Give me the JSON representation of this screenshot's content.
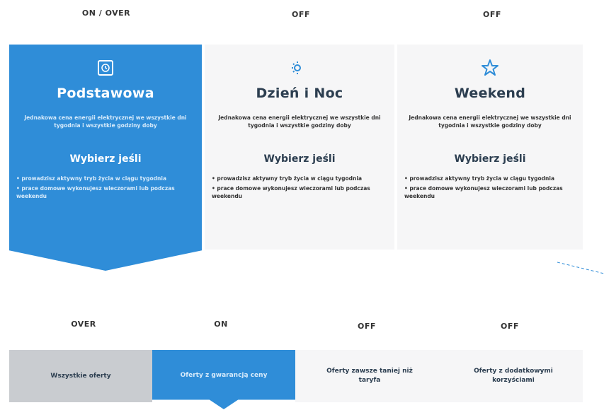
{
  "labels": {
    "top": [
      "ON / OVER",
      "OFF",
      "OFF"
    ],
    "bottom": [
      "OVER",
      "ON",
      "OFF",
      "OFF"
    ]
  },
  "cards": [
    {
      "icon": "clock-box-icon",
      "title": "Podstawowa",
      "description": "Jednakowa cena energii elektrycznej we wszystkie dni tygodnia i wszystkie godziny doby",
      "subtitle": "Wybierz jeśli",
      "bullets": [
        "prowadzisz aktywny tryb życia w ciągu tygodnia",
        "prace domowe wykonujesz wieczorami lub podczas weekendu"
      ]
    },
    {
      "icon": "sun-moon-icon",
      "title": "Dzień i Noc",
      "description": "Jednakowa cena energii elektrycznej we wszystkie dni tygodnia i wszystkie godziny doby",
      "subtitle": "Wybierz jeśli",
      "bullets": [
        "prowadzisz aktywny tryb życia w ciągu tygodnia",
        "prace domowe wykonujesz wieczorami lub podczas weekendu"
      ]
    },
    {
      "icon": "star-icon",
      "title": "Weekend",
      "description": "Jednakowa cena energii elektrycznej we wszystkie dni tygodnia i wszystkie godziny doby",
      "subtitle": "Wybierz jeśli",
      "bullets": [
        "prowadzisz aktywny tryb życia w ciągu tygodnia",
        "prace domowe wykonujesz wieczorami lub podczas weekendu"
      ]
    }
  ],
  "tabs": [
    "Wszystkie oferty",
    "Oferty z gwarancją ceny",
    "Oferty zawsze taniej niż taryfa",
    "Oferty z dodatkowymi korzyściami"
  ],
  "colors": {
    "accent": "#2f8dd8",
    "off_bg": "#f6f6f7",
    "over_bg": "#c9ccd0",
    "title": "#2c3e50"
  }
}
